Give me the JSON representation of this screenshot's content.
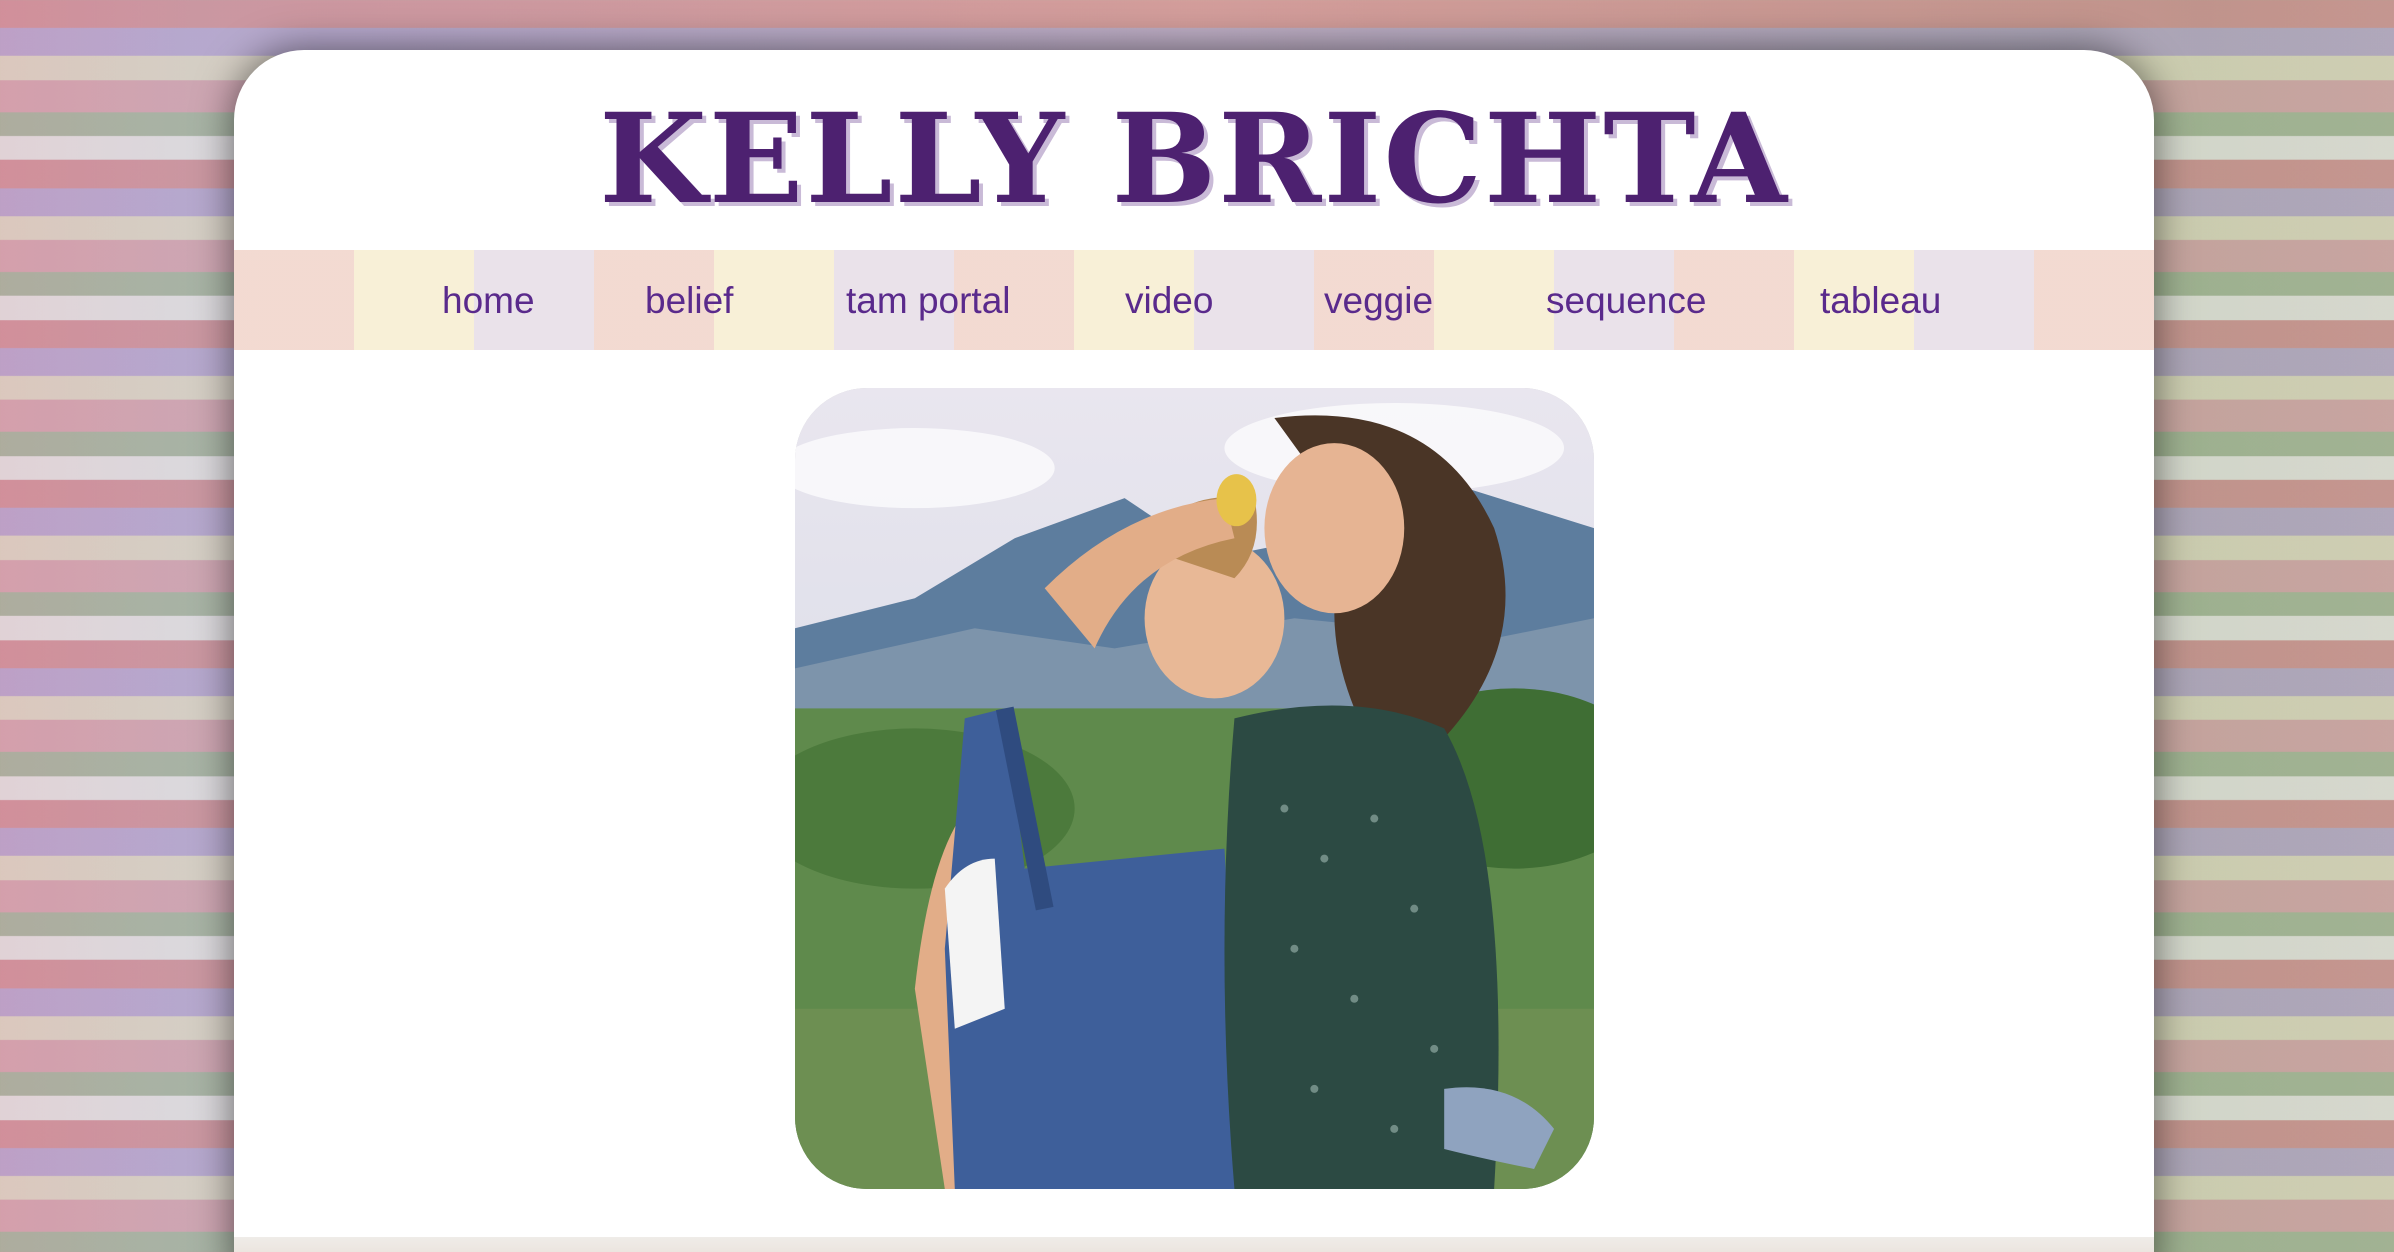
{
  "site": {
    "title": "KELLY BRICHTA"
  },
  "nav": {
    "items": [
      {
        "label": "home"
      },
      {
        "label": "belief"
      },
      {
        "label": "tam portal"
      },
      {
        "label": "video"
      },
      {
        "label": "veggie"
      },
      {
        "label": "sequence"
      },
      {
        "label": "tableau"
      }
    ]
  },
  "photo": {
    "icon": "photo-two-women-laughing"
  },
  "colors": {
    "brand_purple": "#4d2170",
    "nav_text": "#5a2a8c",
    "card_bg": "#ffffff"
  }
}
